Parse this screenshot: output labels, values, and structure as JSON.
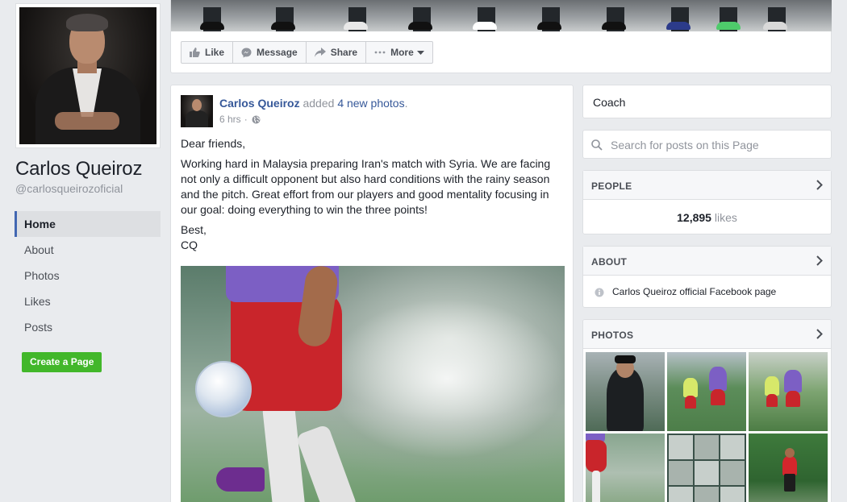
{
  "page": {
    "name": "Carlos Queiroz",
    "handle": "@carlosqueirozoficial"
  },
  "left_nav": {
    "items": [
      {
        "label": "Home",
        "active": true
      },
      {
        "label": "About",
        "active": false
      },
      {
        "label": "Photos",
        "active": false
      },
      {
        "label": "Likes",
        "active": false
      },
      {
        "label": "Posts",
        "active": false
      }
    ],
    "create_page_label": "Create a Page"
  },
  "action_bar": {
    "like": "Like",
    "message": "Message",
    "share": "Share",
    "more": "More"
  },
  "post": {
    "author": "Carlos Queiroz",
    "action_text": " added ",
    "photo_link": "4 new photos",
    "period": ".",
    "time": "6 hrs",
    "privacy_sep": "·",
    "paragraphs": [
      "Dear friends,",
      "Working hard in Malaysia preparing Iran's match with Syria. We are facing not only a difficult opponent but also hard conditions with the rainy season and the pitch. Great effort from our players and good mentality focusing in our goal: doing everything to win the three points!",
      "Best,",
      "CQ"
    ]
  },
  "sidebar": {
    "category": "Coach",
    "search_placeholder": "Search for posts on this Page",
    "people": {
      "title": "PEOPLE",
      "likes_count": "12,895",
      "likes_label": " likes"
    },
    "about": {
      "title": "ABOUT",
      "description": "Carlos Queiroz official Facebook page"
    },
    "photos": {
      "title": "PHOTOS"
    }
  },
  "colors": {
    "link": "#365899",
    "accent": "#4267b2",
    "create_button": "#42b72a",
    "page_bg": "#e9ebee"
  }
}
